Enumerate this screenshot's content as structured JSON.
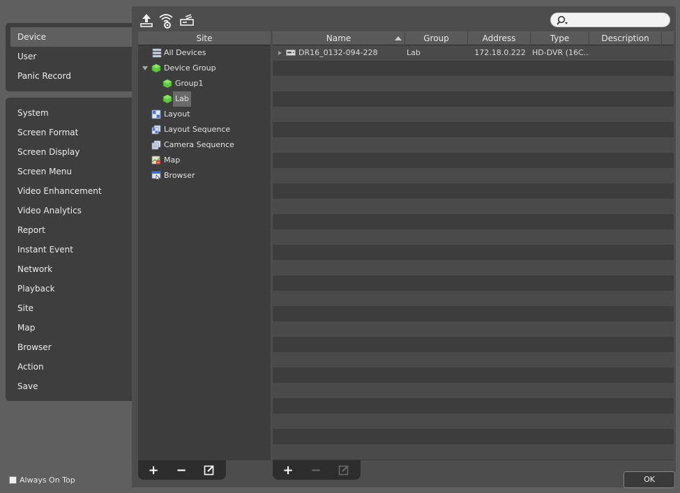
{
  "menu_top": [
    "Device",
    "User",
    "Panic Record"
  ],
  "menu_bottom": [
    "System",
    "Screen Format",
    "Screen Display",
    "Screen Menu",
    "Video Enhancement",
    "Video Analytics",
    "Report",
    "Instant Event",
    "Network",
    "Playback",
    "Site",
    "Map",
    "Browser",
    "Action",
    "Save"
  ],
  "active_menu": "Device",
  "toolbar": {
    "icons": [
      "upload-icon",
      "wireless-settings-icon",
      "device-scan-icon"
    ],
    "search_placeholder": ""
  },
  "site": {
    "header": "Site",
    "tree": {
      "all_devices": "All Devices",
      "device_group": "Device Group",
      "group1": "Group1",
      "lab": "Lab",
      "layout": "Layout",
      "layout_sequence": "Layout Sequence",
      "camera_sequence": "Camera Sequence",
      "map": "Map",
      "browser": "Browser"
    },
    "selected": "Lab"
  },
  "table": {
    "columns": {
      "name": "Name",
      "group": "Group",
      "address": "Address",
      "type": "Type",
      "description": "Description"
    },
    "sort_column": "Name",
    "sort_direction": "ascending",
    "rows": [
      {
        "name": "DR16_0132-094-228",
        "group": "Lab",
        "address": "172.18.0.222",
        "type": "HD-DVR (16C...",
        "description": ""
      }
    ]
  },
  "bottom": {
    "always_on_top": "Always On Top",
    "ok": "OK"
  },
  "colors": {
    "background": "#5f5f5f",
    "panel": "#3e3e3e",
    "group_green": "#5dcb3c"
  }
}
